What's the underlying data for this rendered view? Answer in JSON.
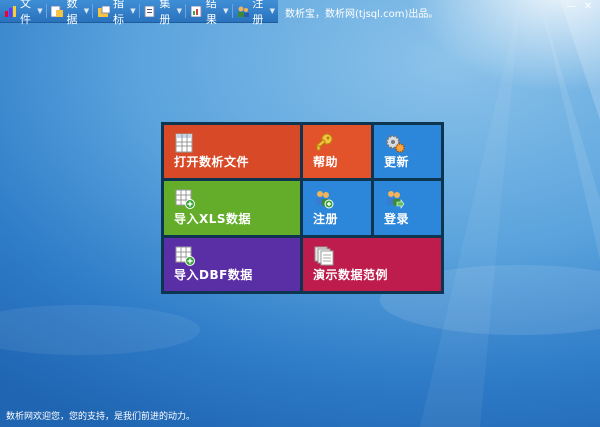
{
  "menubar": {
    "items": [
      {
        "label": "文件",
        "icon": "bar-chart-icon"
      },
      {
        "label": "数据",
        "icon": "data-icon"
      },
      {
        "label": "指标",
        "icon": "indicator-icon"
      },
      {
        "label": "集册",
        "icon": "volume-icon"
      },
      {
        "label": "结果",
        "icon": "result-icon"
      },
      {
        "label": "注册",
        "icon": "register-icon"
      }
    ],
    "dropdown_glyph": "▼"
  },
  "app_title": "数析宝，数析网(tjsql.com)出品。",
  "window_buttons": {
    "minimize": "—",
    "close": "✕"
  },
  "tiles": {
    "open": {
      "label": "打开数析文件",
      "icon": "table-document-icon",
      "color": "#d84a27"
    },
    "help": {
      "label": "帮助",
      "icon": "key-icon",
      "color": "#e2532b"
    },
    "update": {
      "label": "更新",
      "icon": "gears-icon",
      "color": "#2c86d9"
    },
    "import_xls": {
      "label": "导入XLS数据",
      "icon": "table-add-icon",
      "color": "#63ad2b"
    },
    "register": {
      "label": "注册",
      "icon": "users-add-icon",
      "color": "#2c86d9"
    },
    "login": {
      "label": "登录",
      "icon": "users-login-icon",
      "color": "#2c86d9"
    },
    "import_dbf": {
      "label": "导入DBF数据",
      "icon": "table-add-icon",
      "color": "#5a2fa6"
    },
    "demo": {
      "label": "演示数据范例",
      "icon": "documents-icon",
      "color": "#be1c4c"
    }
  },
  "status_text": "数析网欢迎您，您的支持，是我们前进的动力。"
}
